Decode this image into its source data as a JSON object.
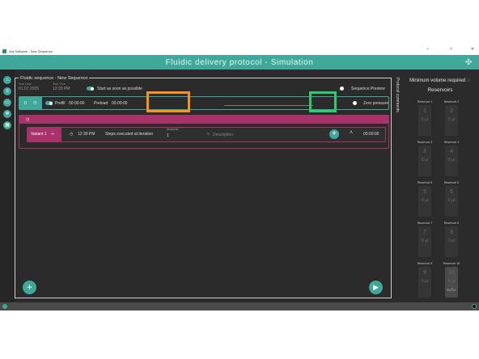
{
  "window": {
    "title": "Ara Software - New Sequence",
    "minimize": "–",
    "maximize": "□",
    "close": "✕"
  },
  "banner": {
    "title": "Fluidic delivery protocol - Simulation"
  },
  "sequence": {
    "title": "Fluidic sequence - New Sequence",
    "start_date_label": "Start Date",
    "start_date": "01.07.2025",
    "start_time_label": "Start Time",
    "start_time": "12:30 PM",
    "start_asap": "Start as soon as possible",
    "preview": "Sequence Preview",
    "zero_pressure": "Zero pressure",
    "prefill": {
      "index": "0",
      "label": "Prefill",
      "time": "00:00:00",
      "preload_label": "Preload",
      "preload_time": "00:00:00"
    },
    "variant": {
      "name": "Variant 1",
      "time": "12:30 PM",
      "steps_text": "Steps executed at iteration",
      "iterations_label": "Iterations",
      "iterations_value": "1",
      "description_placeholder": "Description",
      "duration": "00:00:00"
    }
  },
  "protocol_comments": "Protocol comments",
  "reservoirs_panel": {
    "title": "Minimum volume required",
    "subtitle": "Reservoirs",
    "items": [
      {
        "label": "Reservoir 1",
        "num": "1",
        "vol": "0 µl"
      },
      {
        "label": "Reservoir 2",
        "num": "2",
        "vol": "0 µl"
      },
      {
        "label": "Reservoir 3",
        "num": "3",
        "vol": "0 µl"
      },
      {
        "label": "Reservoir 4",
        "num": "4",
        "vol": "0 µl"
      },
      {
        "label": "Reservoir 5",
        "num": "5",
        "vol": "0 µl"
      },
      {
        "label": "Reservoir 6",
        "num": "6",
        "vol": "0 µl"
      },
      {
        "label": "Reservoir 7",
        "num": "7",
        "vol": "0 µl"
      },
      {
        "label": "Reservoir 8",
        "num": "8",
        "vol": "0 µl"
      },
      {
        "label": "Reservoir 9",
        "num": "9",
        "vol": "0 µl"
      },
      {
        "label": "Reservoir 10",
        "num": "10",
        "vol": "0 µl",
        "name": "Buffer"
      }
    ]
  },
  "colors": {
    "accent": "#3fa89a",
    "variant": "#a8336b",
    "iterations_highlight": "#f7941d",
    "add_highlight": "#2dcc70"
  }
}
